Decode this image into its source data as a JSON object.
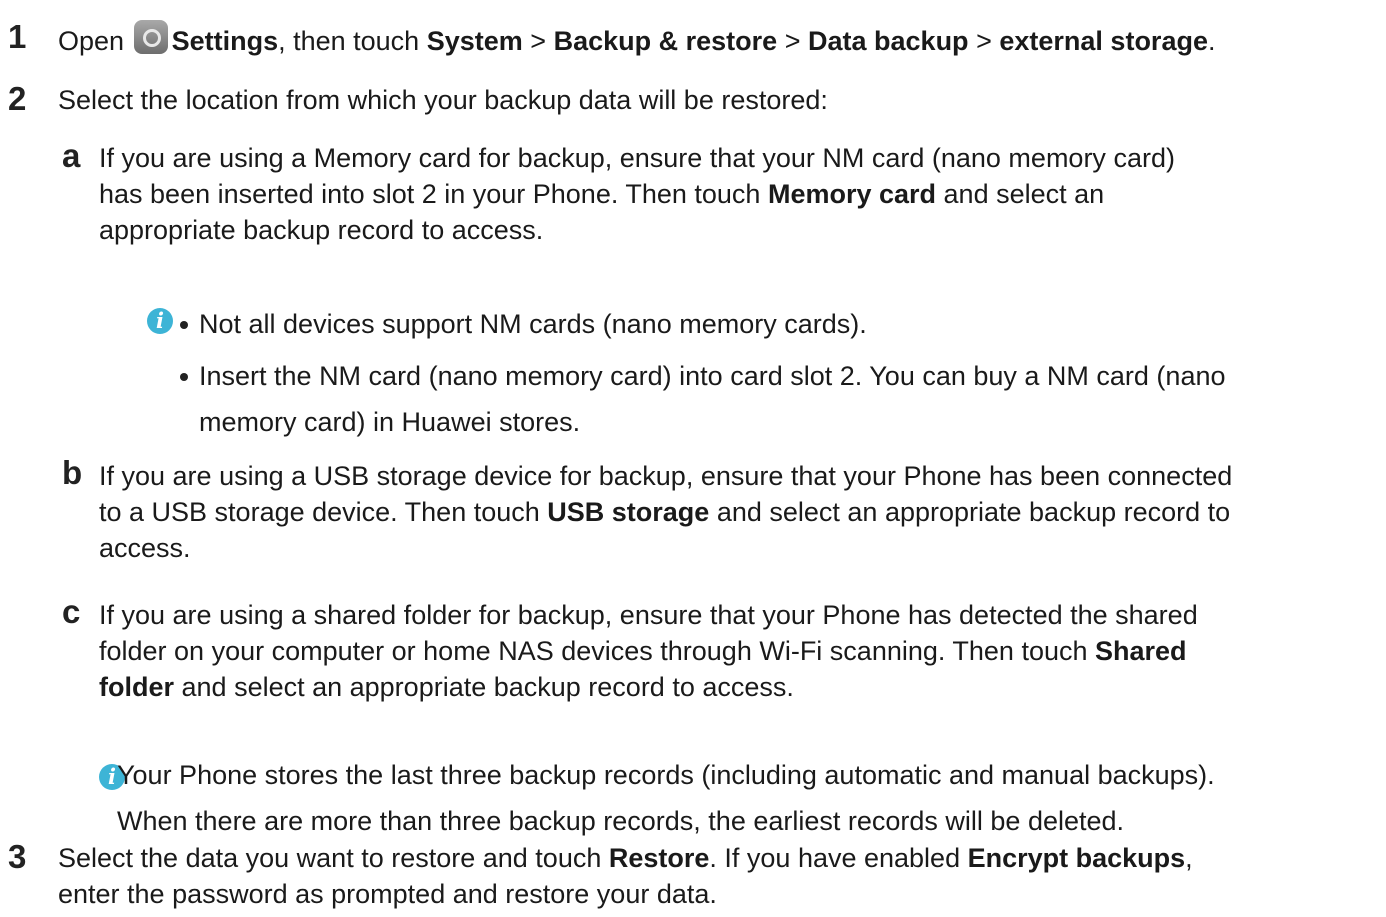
{
  "step1": {
    "number": "1",
    "open": "Open",
    "settings": "Settings",
    "then_touch": ", then touch",
    "system": "System",
    "sep1": ">",
    "backup_restore": "Backup & restore",
    "sep2": ">",
    "data_backup": "Data backup",
    "sep3": ">",
    "external_storage": "external storage",
    "end": ".",
    "settings_icon": "settings-gear-icon"
  },
  "step2": {
    "number": "2",
    "text": "Select the location from which your backup data will be restored:"
  },
  "sub_a": {
    "letter": "a",
    "line1": "If you are using a Memory card for backup, ensure that your NM card (nano memory card)",
    "line2_pre": "has been inserted into slot 2 in your Phone. Then touch ",
    "line2_bold": "Memory card",
    "line2_post": " and select an",
    "line3": "appropriate backup record to access.",
    "note_bullet1": "Not all devices support NM cards (nano memory cards).",
    "note_bullet2_line1": "Insert the NM card (nano memory card) into card slot 2. You can buy a NM card (nano",
    "note_bullet2_line2": "memory card) in Huawei stores."
  },
  "sub_b": {
    "letter": "b",
    "line1": "If you are using a USB storage device for backup, ensure that your Phone has been connected",
    "line2_pre": "to a USB storage device. Then touch ",
    "line2_bold": "USB storage",
    "line2_post": " and select an appropriate backup record to",
    "line3": "access."
  },
  "sub_c": {
    "letter": "c",
    "line1": "If you are using a shared folder for backup, ensure that your Phone has detected the shared",
    "line2_pre": "folder on your computer or home NAS devices through Wi-Fi scanning. Then touch ",
    "line2_bold": "Shared",
    "line3_bold": "folder",
    "line3_post": " and select an appropriate backup record to access."
  },
  "note2": {
    "line1": "Your Phone stores the last three backup records (including automatic and manual backups).",
    "line2": "When there are more than three backup records, the earliest records will be deleted."
  },
  "step3": {
    "number": "3",
    "line1_pre": "Select the data you want to restore and touch ",
    "restore": "Restore",
    "line1_mid": ". If you have enabled ",
    "encrypt": "Encrypt backups",
    "line1_end": ",",
    "line2": "enter the password as prompted and restore your data."
  },
  "colors": {
    "note_icon": "#3db4d6",
    "text": "#1a1a1a"
  }
}
